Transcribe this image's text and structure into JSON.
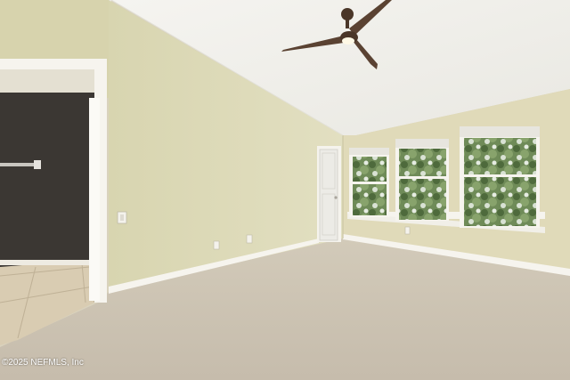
{
  "watermark": "©2025 NEFMLS, Inc",
  "colors": {
    "ceiling": "#f0efea",
    "wall_left": "#dcd9b6",
    "wall_back": "#e2dcbc",
    "wall_right": "#ddd7b2",
    "carpet": "#cdc4b4",
    "dark_wall": "#3b3733",
    "trim": "#f6f4ee",
    "fan": "#5a4232",
    "foliage": "#5e7a4a"
  },
  "icons": [
    "ceiling-fan-icon",
    "light-switch-icon",
    "outlet-icon",
    "door-icon",
    "window-icon"
  ]
}
